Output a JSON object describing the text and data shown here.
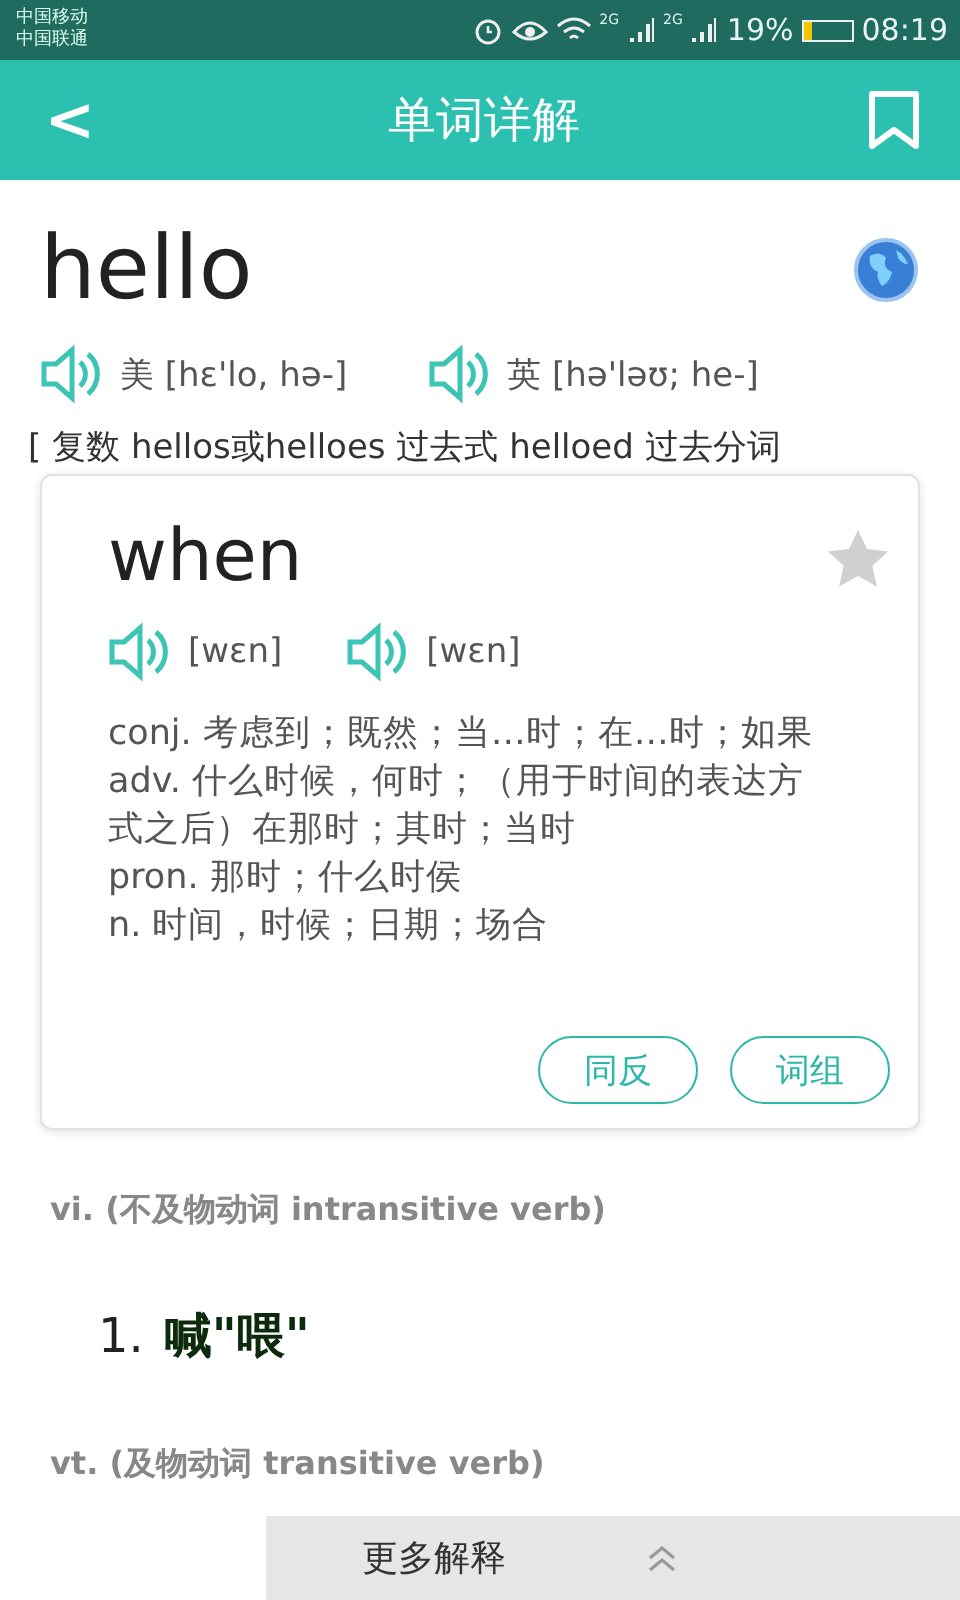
{
  "status_bar": {
    "carriers": [
      "中国移动",
      "中国联通"
    ],
    "network_1": "2G",
    "network_2": "2G",
    "battery": "19%",
    "time": "08:19"
  },
  "header": {
    "back": "<",
    "title": "单词详解",
    "bookmarked": false
  },
  "word": {
    "text": "hello",
    "pronunciations": [
      {
        "text": "美 [hɛ'lo, hə-]"
      },
      {
        "text": "英 [hə'ləʊ; he-]"
      }
    ],
    "forms": "[ 复数 hellos或helloes 过去式 helloed 过去分词"
  },
  "popup": {
    "word": "when",
    "starred": false,
    "pronunciations": [
      {
        "text": "[wɛn]"
      },
      {
        "text": "[wɛn]"
      }
    ],
    "definitions": [
      "conj. 考虑到；既然；当…时；在…时；如果",
      "adv. 什么时候，何时；（用于时间的表达方式之后）在那时；其时；当时",
      "pron. 那时；什么时侯",
      "n. 时间，时候；日期；场合"
    ],
    "buttons": [
      "同反",
      "词组"
    ]
  },
  "senses": [
    {
      "pos": "vi. (不及物动词 intransitive verb)",
      "items": [
        {
          "number": "1.",
          "meaning": "喊\"喂\""
        }
      ]
    },
    {
      "pos": "vt. (及物动词 transitive verb)"
    }
  ],
  "more_bar": {
    "label": "更多解释"
  }
}
